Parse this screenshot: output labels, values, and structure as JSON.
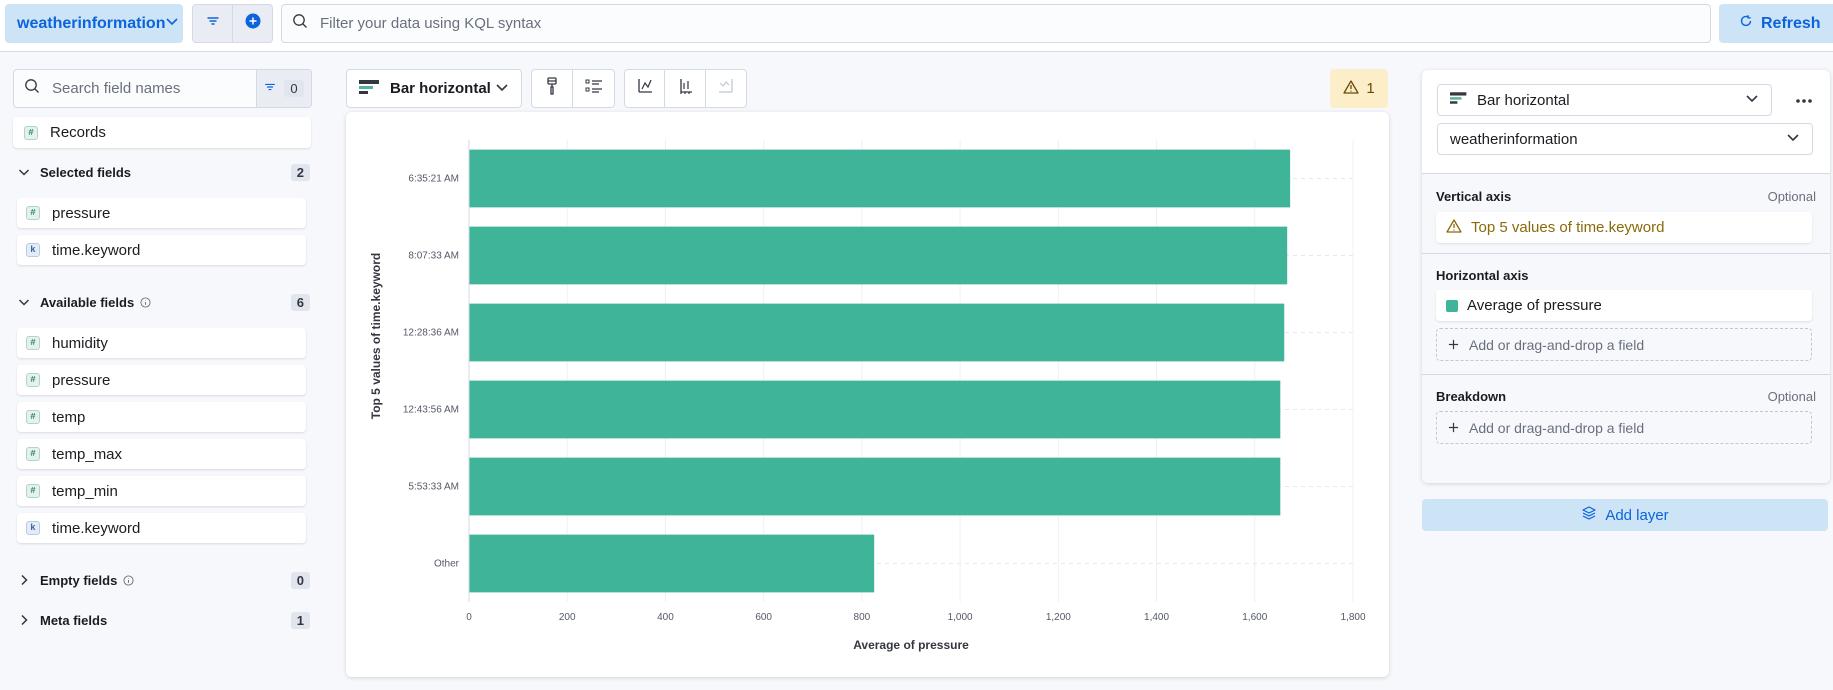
{
  "topbar": {
    "data_view": "weatherinformation",
    "query_placeholder": "Filter your data using KQL syntax",
    "refresh_label": "Refresh"
  },
  "sidebar": {
    "search_placeholder": "Search field names",
    "filter_count": "0",
    "records_label": "Records",
    "groups": {
      "selected": {
        "label": "Selected fields",
        "count": "2",
        "items": [
          {
            "type": "number",
            "name": "pressure"
          },
          {
            "type": "keyword",
            "name": "time.keyword"
          }
        ]
      },
      "available": {
        "label": "Available fields",
        "count": "6",
        "items": [
          {
            "type": "number",
            "name": "humidity"
          },
          {
            "type": "number",
            "name": "pressure"
          },
          {
            "type": "number",
            "name": "temp"
          },
          {
            "type": "number",
            "name": "temp_max"
          },
          {
            "type": "number",
            "name": "temp_min"
          },
          {
            "type": "keyword",
            "name": "time.keyword"
          }
        ]
      },
      "empty": {
        "label": "Empty fields",
        "count": "0"
      },
      "meta": {
        "label": "Meta fields",
        "count": "1"
      }
    }
  },
  "workspace": {
    "chart_type": "Bar horizontal",
    "warning_count": "1"
  },
  "chart_data": {
    "type": "bar",
    "orientation": "horizontal",
    "categories": [
      "6:35:21 AM",
      "8:07:33 AM",
      "12:28:36 AM",
      "12:43:56 AM",
      "5:53:33 AM",
      "Other"
    ],
    "series": [
      {
        "name": "Average of pressure",
        "values": [
          1672,
          1666,
          1660,
          1652,
          1652,
          825
        ]
      }
    ],
    "xlabel": "Average of pressure",
    "ylabel": "Top 5 values of time.keyword",
    "xlim": [
      0,
      1800
    ],
    "xticks": [
      "0",
      "200",
      "400",
      "600",
      "800",
      "1,000",
      "1,200",
      "1,400",
      "1,600",
      "1,800"
    ],
    "grid": true,
    "color": "#3fb499"
  },
  "config": {
    "layer_type": "Bar horizontal",
    "data_view": "weatherinformation",
    "vertical_axis": {
      "label": "Vertical axis",
      "optional": "Optional",
      "dimension": "Top 5 values of time.keyword"
    },
    "horizontal_axis": {
      "label": "Horizontal axis",
      "dimension": "Average of pressure",
      "add": "Add or drag-and-drop a field"
    },
    "breakdown": {
      "label": "Breakdown",
      "optional": "Optional",
      "add": "Add or drag-and-drop a field"
    },
    "add_layer": "Add layer"
  },
  "colors": {
    "accent": "#0b64dd",
    "accent_bg": "#cce4f5",
    "bar": "#3fb499",
    "warning_bg": "#fdeeca"
  }
}
